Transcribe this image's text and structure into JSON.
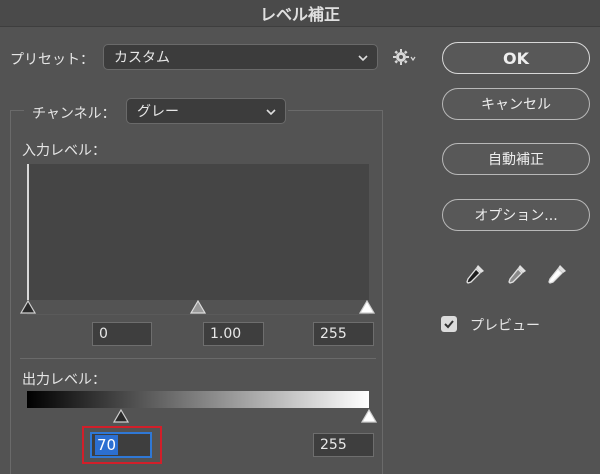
{
  "window": {
    "title": "レベル補正"
  },
  "preset": {
    "label": "プリセット：",
    "value": "カスタム",
    "gear_icon": "gear-icon"
  },
  "channel": {
    "label": "チャンネル：",
    "value": "グレー"
  },
  "input_levels": {
    "label": "入力レベル：",
    "shadow": "0",
    "midtone": "1.00",
    "highlight": "255"
  },
  "output_levels": {
    "label": "出力レベル：",
    "shadow": "70",
    "highlight": "255",
    "shadow_fraction": 0.275,
    "highlight_fraction": 1.0
  },
  "buttons": {
    "ok": "OK",
    "cancel": "キャンセル",
    "auto": "自動補正",
    "options": "オプション..."
  },
  "preview": {
    "label": "プレビュー",
    "checked": true
  },
  "colors": {
    "accent": "#2c6fd1",
    "highlight_border": "#d21f2a",
    "background": "#535353"
  }
}
